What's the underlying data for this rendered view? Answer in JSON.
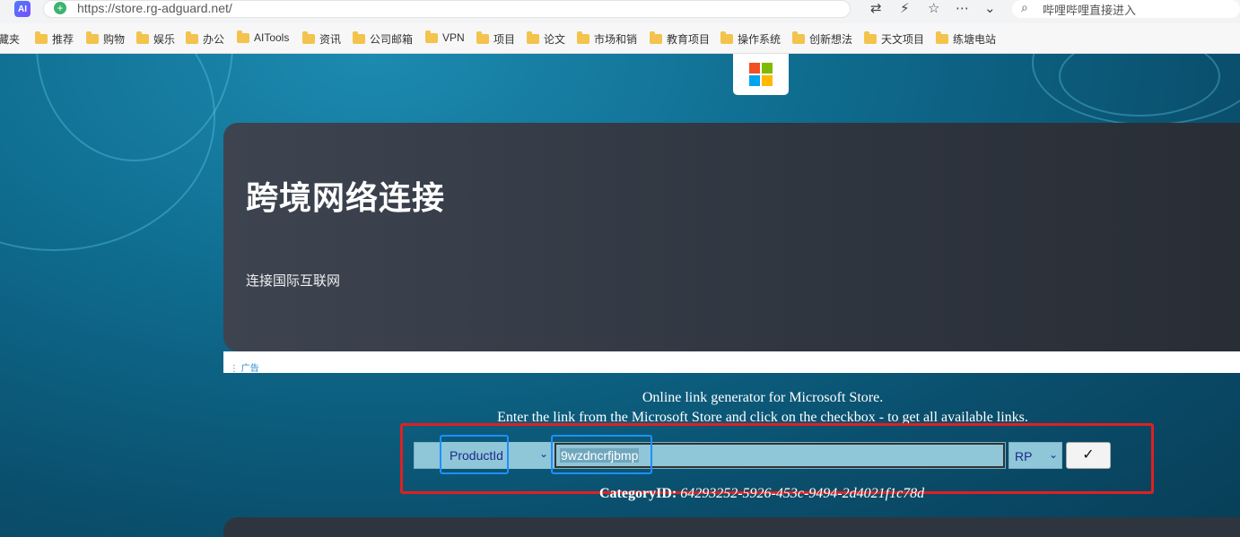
{
  "browser": {
    "ai_badge": "AI",
    "url": "https://store.rg-adguard.net/",
    "search_placeholder": "哔哩哔哩直接进入",
    "bookmarks": [
      "收藏夹",
      "推荐",
      "购物",
      "娱乐",
      "办公",
      "AITools",
      "资讯",
      "公司邮箱",
      "VPN",
      "项目",
      "论文",
      "市场和销",
      "教育项目",
      "操作系统",
      "创新想法",
      "天文项目",
      "练塘电站"
    ]
  },
  "hero": {
    "title": "跨境网络连接",
    "subtitle": "连接国际互联网"
  },
  "ad_label": "广告",
  "generator": {
    "line1": "Online link generator for Microsoft Store.",
    "line2": "Enter the link from the Microsoft Store and click on the checkbox - to get all available links.",
    "type_selected": "ProductId",
    "input_value": "9wzdncrfjbmp",
    "ring_selected": "RP",
    "submit_label": "✓",
    "category_label": "CategoryID:",
    "category_value": "64293252-5926-453c-9494-2d4021f1c78d"
  },
  "colors": {
    "highlight_red": "#e02020",
    "highlight_blue": "#1e90ff",
    "ms_red": "#f25022",
    "ms_green": "#7fba00",
    "ms_blue": "#00a4ef",
    "ms_yellow": "#ffb900"
  }
}
